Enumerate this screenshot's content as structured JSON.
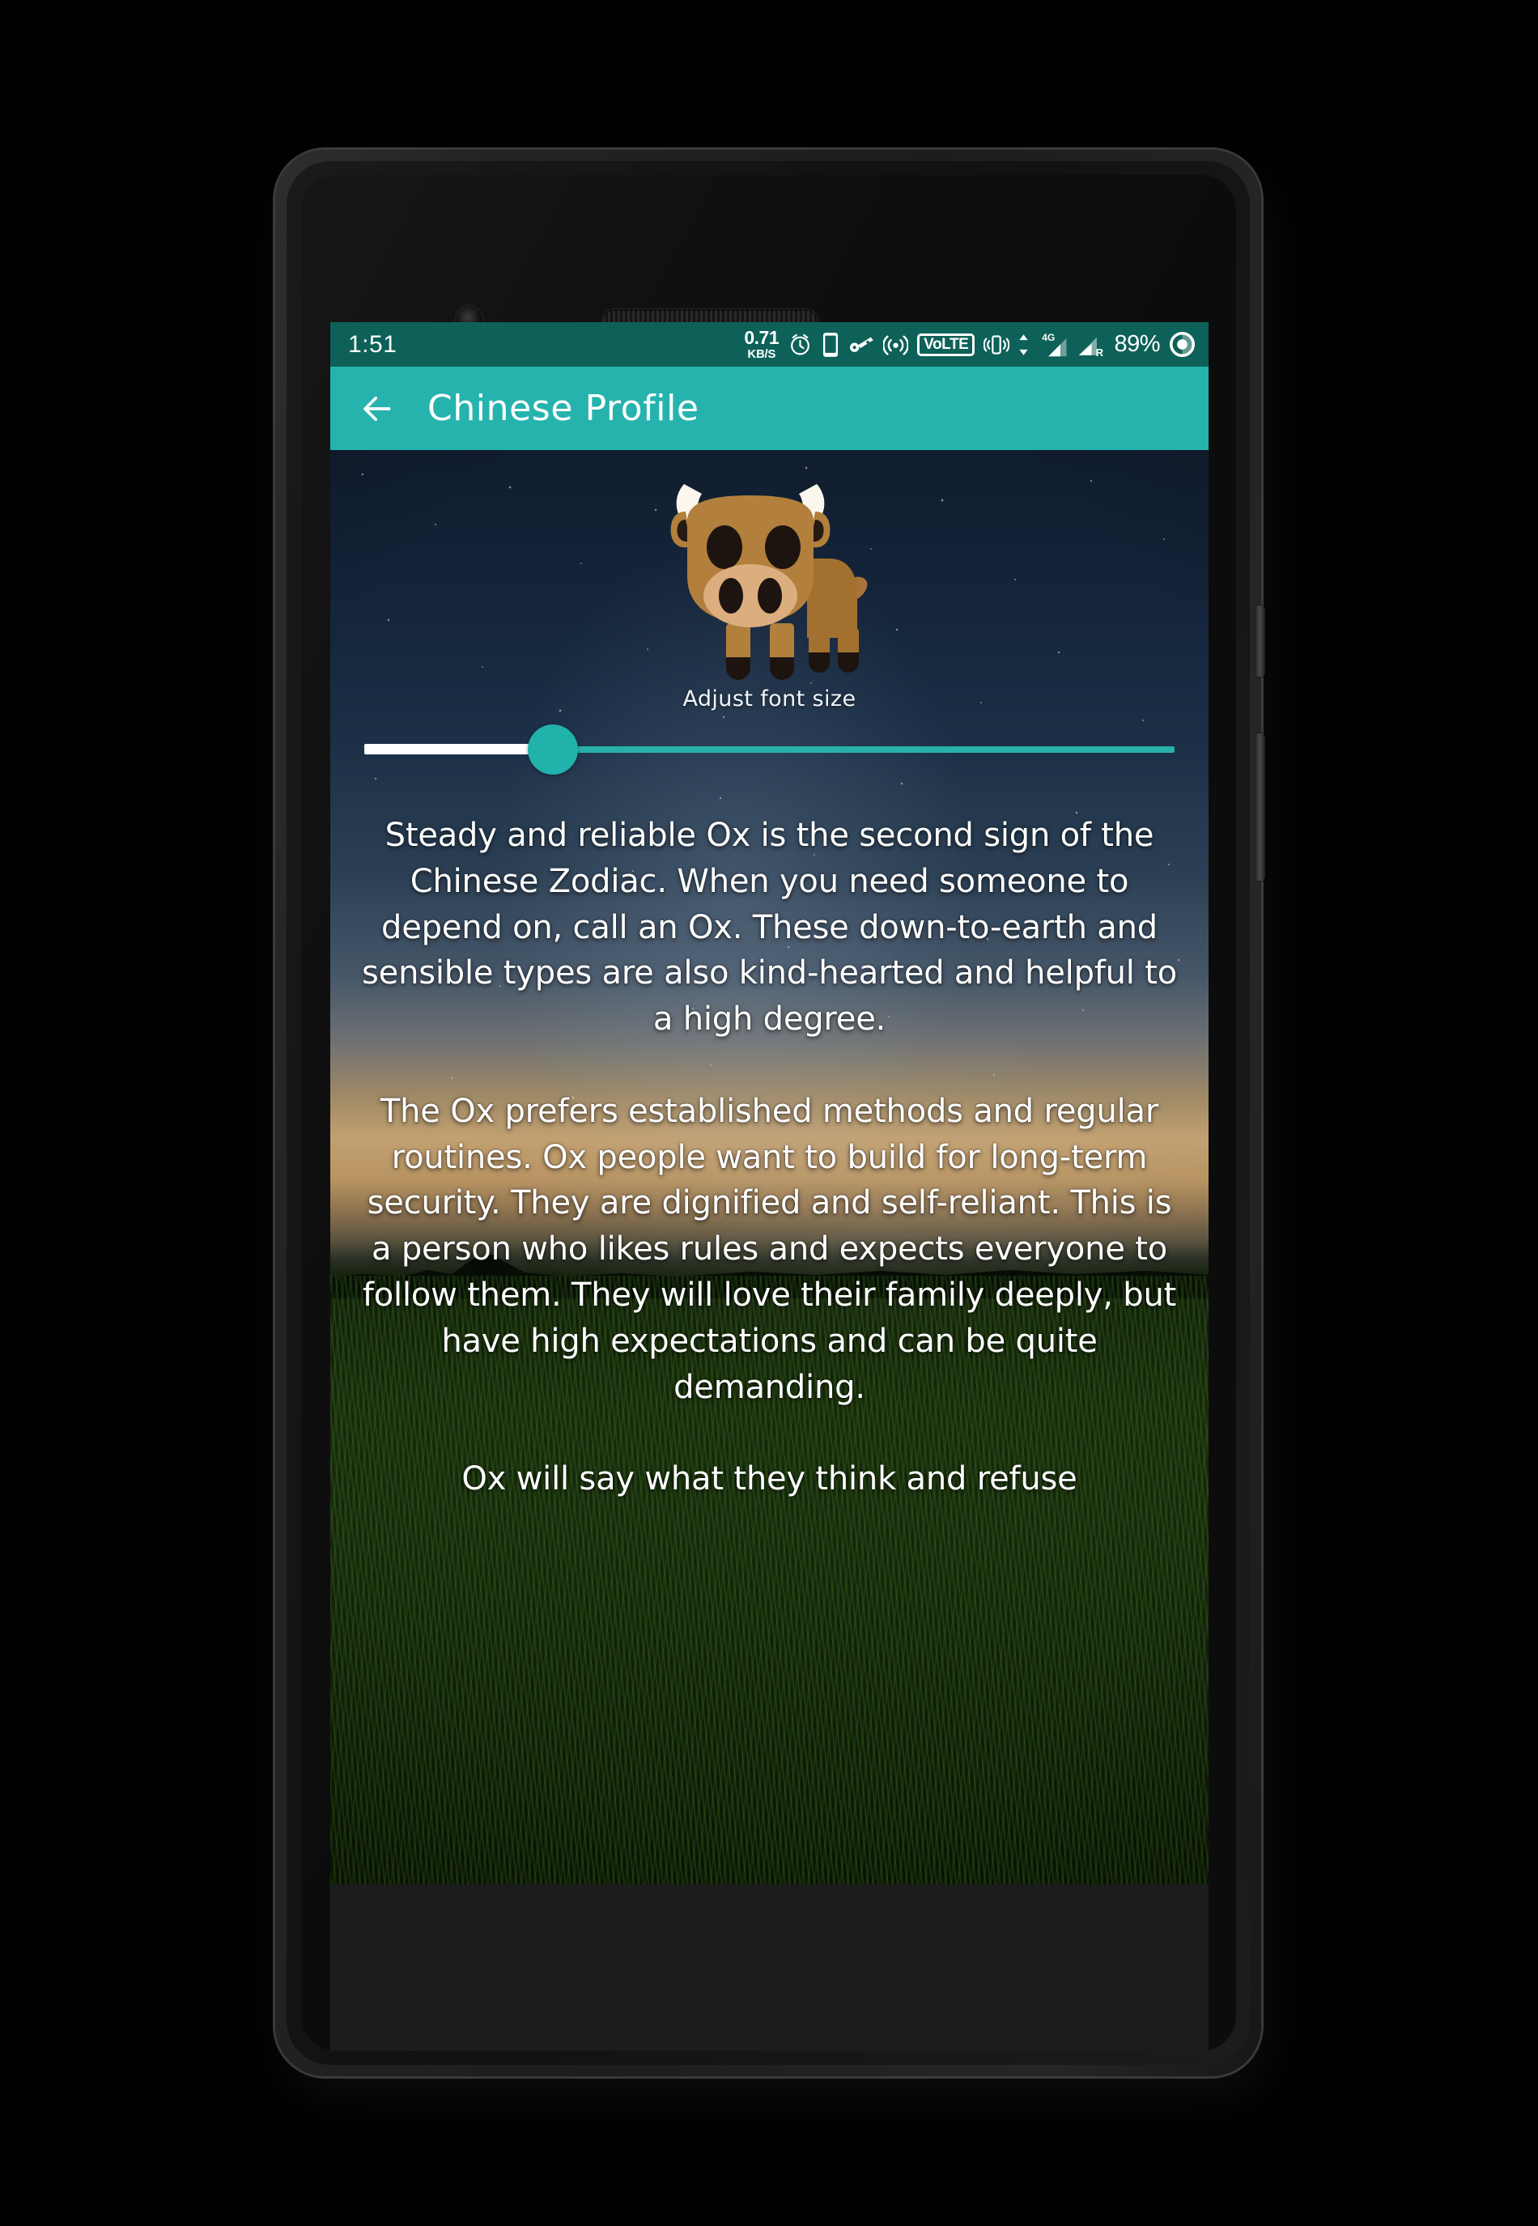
{
  "device": {
    "name": "android-phone-mockup",
    "frame_color": "#232323",
    "front_camera": "front-camera",
    "earpiece": "earpiece-speaker",
    "bottom_speaker": "bottom-speaker",
    "buttons": [
      "power-button",
      "volume-rocker"
    ]
  },
  "status_bar": {
    "background": "#0d6158",
    "time": "1:51",
    "net_speed_value": "0.71",
    "net_speed_unit": "KB/S",
    "icons": [
      "alarm-clock-icon",
      "phone-device-icon",
      "vpn-key-icon",
      "hotspot-icon",
      "volte-icon",
      "vibrate-icon",
      "data-transfer-arrows-icon",
      "signal-4g-icon",
      "signal-roaming-icon",
      "battery-icon"
    ],
    "volte_label": "VoLTE",
    "network_type": "4G",
    "roaming_label": "R",
    "battery_percent": "89%"
  },
  "app_bar": {
    "background": "#26b3ae",
    "back_icon": "back-arrow-icon",
    "title": "Chinese Profile"
  },
  "content": {
    "zodiac_emoji_name": "ox-emoji",
    "slider": {
      "label": "Adjust font size",
      "value_percent": 22,
      "active_color": "#ffffff",
      "inactive_color": "#28b1ab",
      "thumb_color": "#21b2ac"
    },
    "paragraphs": [
      "Steady and reliable Ox is the second sign of the Chinese Zodiac. When you need someone to depend on, call an Ox. These down-to-earth and sensible types are also kind-hearted and helpful to a high degree.",
      "The Ox prefers established methods and regular routines. Ox people want to build for long-term security. They are dignified and self-reliant. This is a person who likes rules and expects everyone to follow them. They will love their family deeply, but have high expectations and can be quite demanding.",
      "Ox will say what they think and refuse"
    ]
  }
}
